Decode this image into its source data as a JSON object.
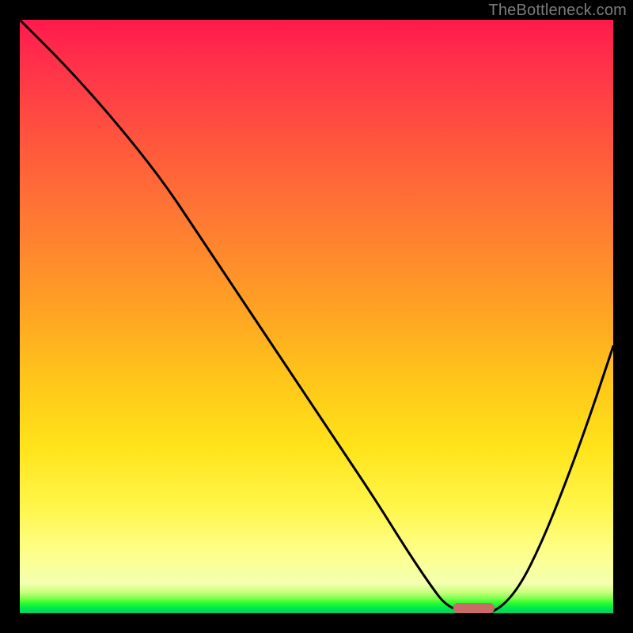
{
  "attribution": "TheBottleneck.com",
  "chart_data": {
    "type": "line",
    "title": "",
    "xlabel": "",
    "ylabel": "",
    "xlim": [
      0,
      100
    ],
    "ylim": [
      0,
      100
    ],
    "background_gradient": {
      "orientation": "vertical",
      "stops": [
        {
          "pos": 0,
          "color": "#ff1a4d"
        },
        {
          "pos": 0.34,
          "color": "#ff7a33"
        },
        {
          "pos": 0.6,
          "color": "#ffc41a"
        },
        {
          "pos": 0.82,
          "color": "#fff64a"
        },
        {
          "pos": 0.95,
          "color": "#f4ffb0"
        },
        {
          "pos": 0.98,
          "color": "#2aff2a"
        },
        {
          "pos": 1.0,
          "color": "#00d060"
        }
      ]
    },
    "series": [
      {
        "name": "bottleneck-curve",
        "color": "#000000",
        "x": [
          0,
          8,
          16,
          24,
          30,
          36,
          42,
          48,
          54,
          60,
          65,
          69,
          72,
          76,
          80,
          84,
          88,
          92,
          96,
          100
        ],
        "y": [
          100,
          92,
          83,
          73,
          64,
          55,
          46,
          37,
          28,
          19,
          11,
          5,
          1,
          0,
          0,
          4,
          12,
          22,
          33,
          45
        ]
      }
    ],
    "marker": {
      "name": "optimal-range",
      "shape": "pill",
      "color": "#c96b66",
      "x_start": 73,
      "x_end": 80,
      "y": 0
    },
    "annotations": []
  }
}
